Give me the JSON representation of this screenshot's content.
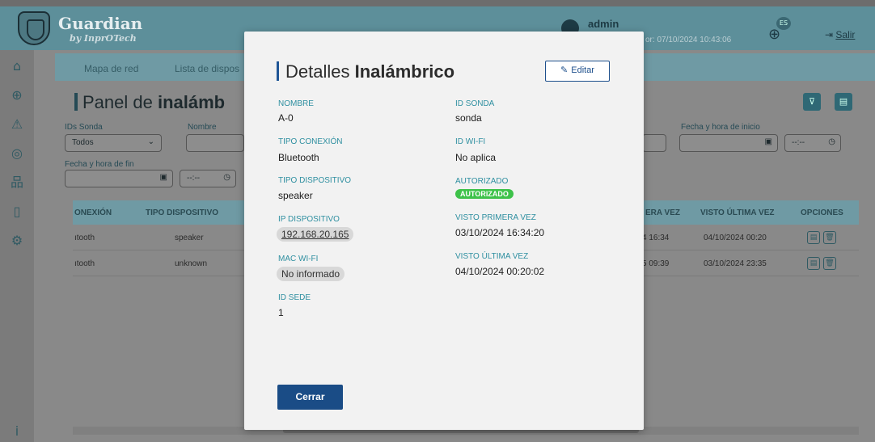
{
  "header": {
    "brand": "Guardian",
    "brand_sub": "by InprOTech",
    "user": "admin",
    "last_login_partial": "or: 07/10/2024 10:43:06",
    "lang": "ES",
    "logout": "Salir"
  },
  "tabs": [
    "Mapa de red",
    "Lista de dispos"
  ],
  "panel": {
    "title_prefix": "Panel de ",
    "title_bold": "inalámb"
  },
  "filters": {
    "ids_sonda_label": "IDs Sonda",
    "ids_sonda_value": "Todos",
    "nombre_label": "Nombre",
    "fecha_inicio_label": "Fecha y hora de inicio",
    "fecha_fin_label": "Fecha y hora de fin",
    "time_placeholder": "--:--"
  },
  "table": {
    "headers": [
      "ONEXIÓN",
      "TIPO DISPOSITIVO",
      "ERA VEZ",
      "VISTO ÚLTIMA VEZ",
      "OPCIONES"
    ],
    "rows": [
      [
        "ıtooth",
        "speaker",
        "4 16:34",
        "04/10/2024 00:20"
      ],
      [
        "ıtooth",
        "unknown",
        "5 09:39",
        "03/10/2024 23:35"
      ]
    ]
  },
  "modal": {
    "title_prefix": "Detalles ",
    "title_bold": "Inalámbrico",
    "edit_label": "Editar",
    "close_label": "Cerrar",
    "fields": {
      "nombre_label": "NOMBRE",
      "nombre_value": "A-0",
      "tipo_conexion_label": "TIPO CONEXIÓN",
      "tipo_conexion_value": "Bluetooth",
      "tipo_dispositivo_label": "TIPO DISPOSITIVO",
      "tipo_dispositivo_value": "speaker",
      "ip_label": "IP DISPOSITIVO",
      "ip_value": "192.168.20.165",
      "mac_label": "MAC WI-FI",
      "mac_value": "No informado",
      "id_sede_label": "ID SEDE",
      "id_sede_value": "1",
      "id_sonda_label": "ID SONDA",
      "id_sonda_value": "sonda",
      "id_wifi_label": "ID WI-FI",
      "id_wifi_value": "No aplica",
      "autorizado_label": "AUTORIZADO",
      "autorizado_value": "AUTORIZADO",
      "visto_primera_label": "VISTO PRIMERA VEZ",
      "visto_primera_value": "03/10/2024 16:34:20",
      "visto_ultima_label": "VISTO ÚLTIMA VEZ",
      "visto_ultima_value": "04/10/2024 00:20:02"
    }
  },
  "colors": {
    "accent": "#1a4c86",
    "label": "#2e8fa0",
    "authorized": "#3ec24a"
  }
}
